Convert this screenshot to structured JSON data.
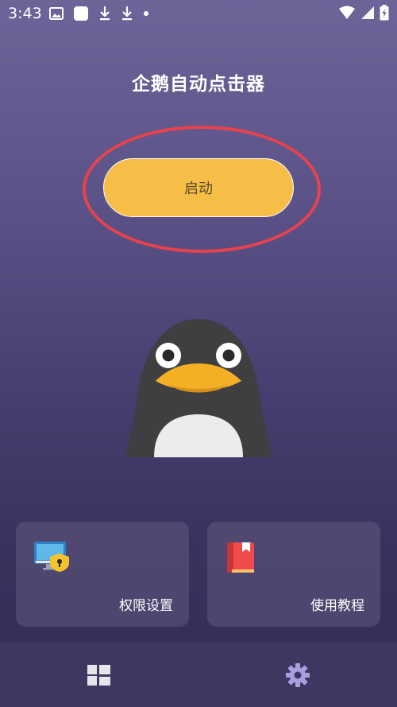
{
  "status_bar": {
    "time": "3:43",
    "left_icons": [
      "image-icon",
      "square-app-icon",
      "download-icon",
      "download-icon",
      "dot-icon"
    ],
    "right_icons": [
      "wifi-icon",
      "signal-icon",
      "battery-charging-icon"
    ]
  },
  "header": {
    "title": "企鹅自动点击器"
  },
  "main": {
    "start_button_label": "启动",
    "highlight_color": "#e8424f",
    "button_color": "#f6bd47"
  },
  "cards": [
    {
      "label": "权限设置",
      "icon": "permission-shield-monitor-icon"
    },
    {
      "label": "使用教程",
      "icon": "tutorial-book-icon"
    }
  ],
  "bottom_nav": {
    "items": [
      {
        "name": "dashboard-icon"
      },
      {
        "name": "gear-icon",
        "color": "#a99fe0"
      }
    ]
  }
}
